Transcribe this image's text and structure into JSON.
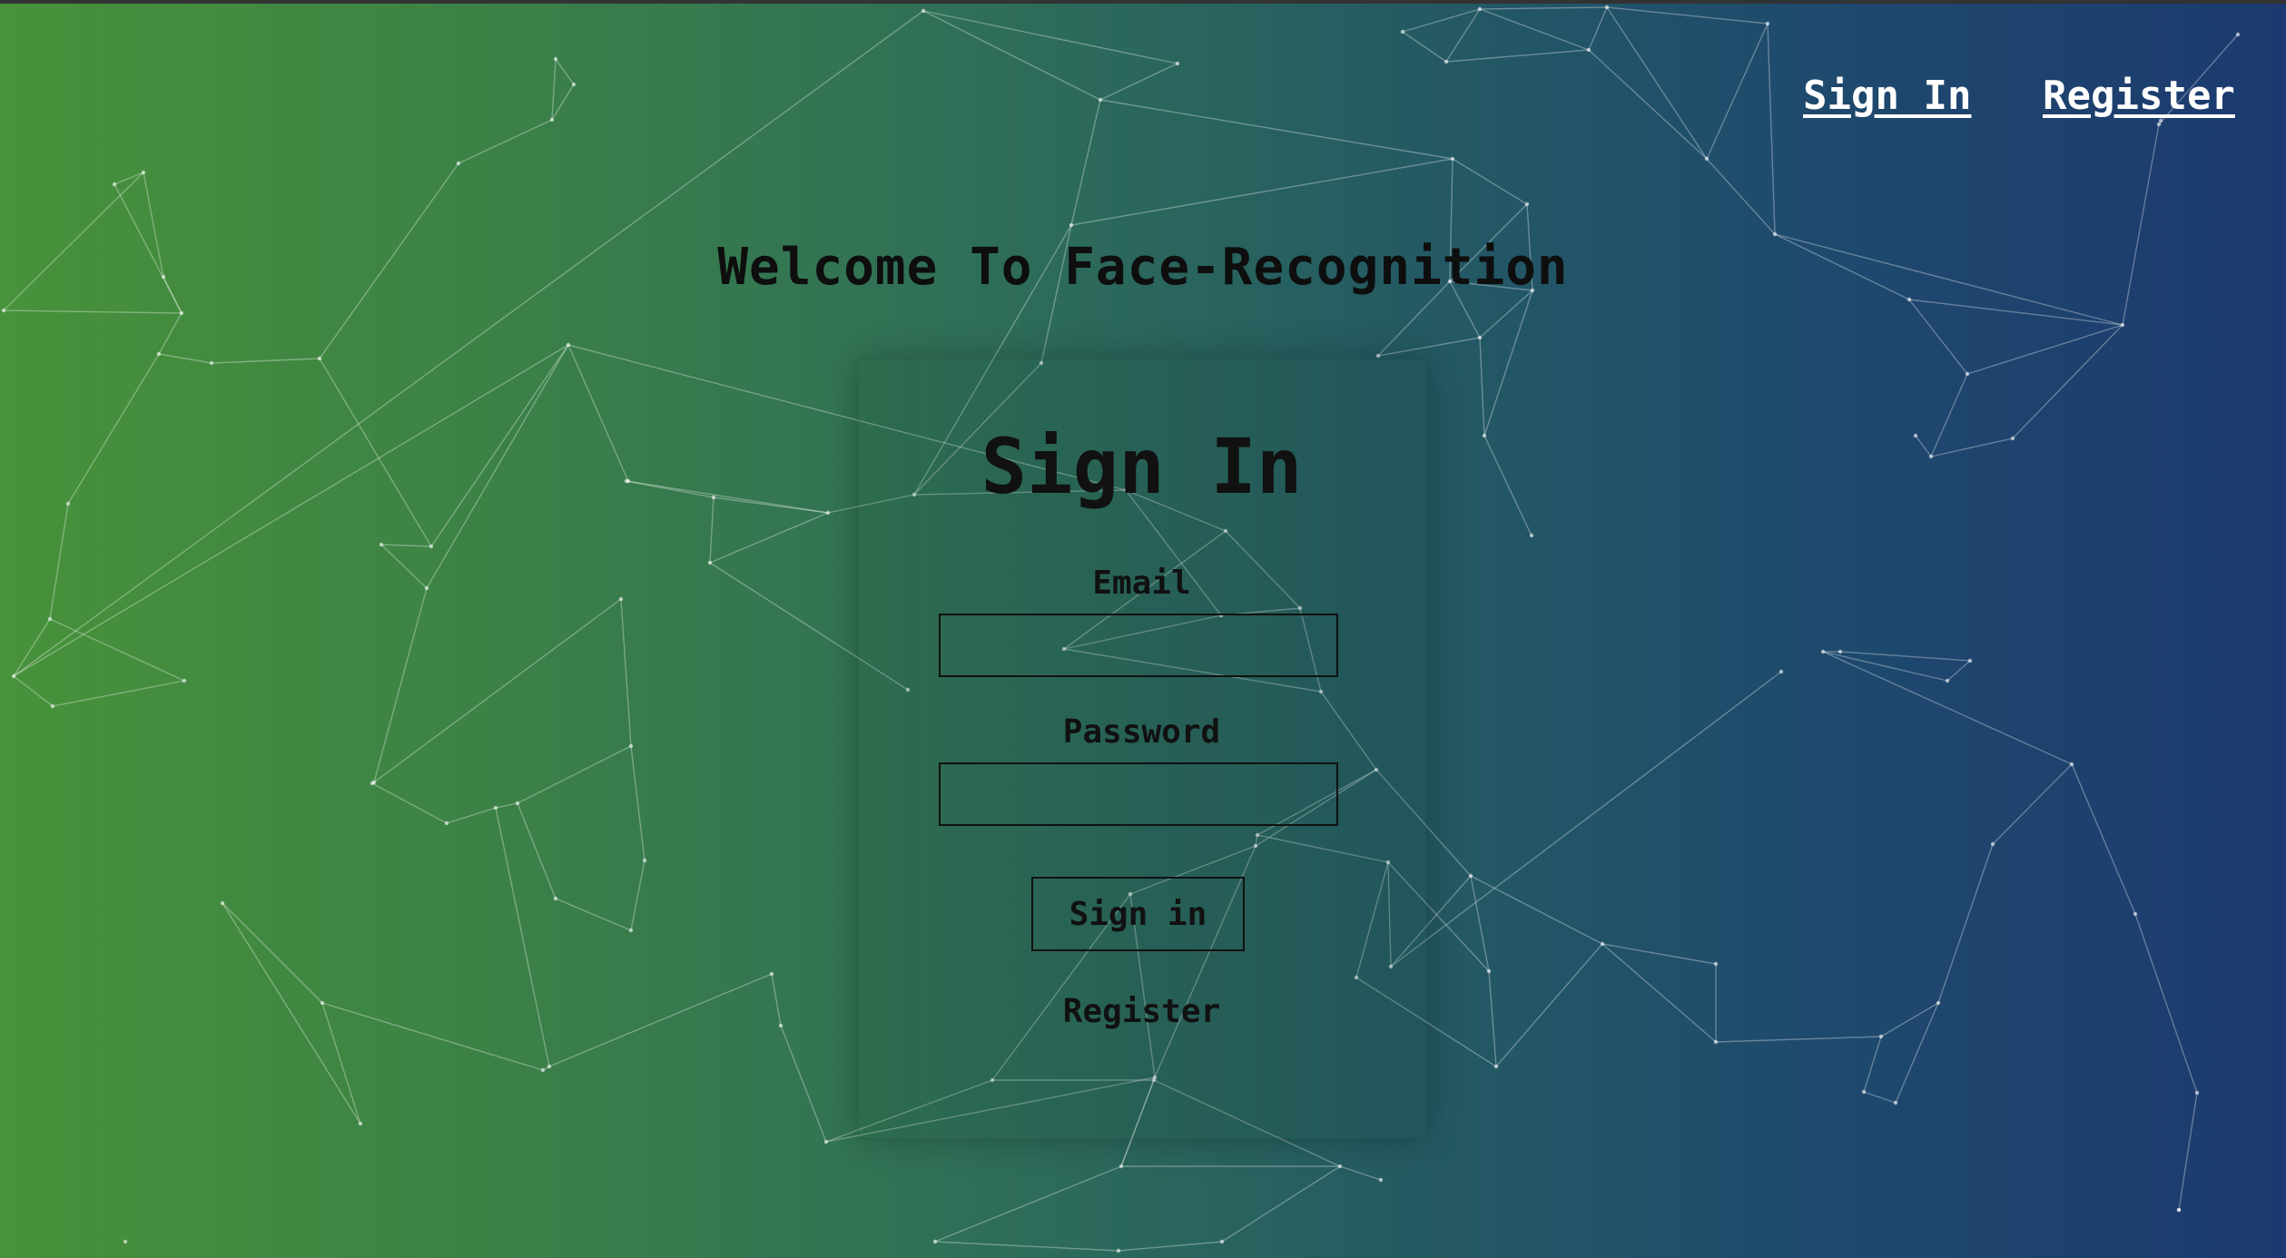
{
  "nav": {
    "signin_label": "Sign In",
    "register_label": "Register"
  },
  "welcome": "Welcome To Face-Recognition",
  "form": {
    "title": "Sign In",
    "email_label": "Email",
    "email_value": "",
    "password_label": "Password",
    "password_value": "",
    "submit_label": "Sign in",
    "register_label": "Register"
  },
  "colors": {
    "gradient_start": "#47923a",
    "gradient_end": "#1c3a6f",
    "network_line": "#ffffff"
  }
}
